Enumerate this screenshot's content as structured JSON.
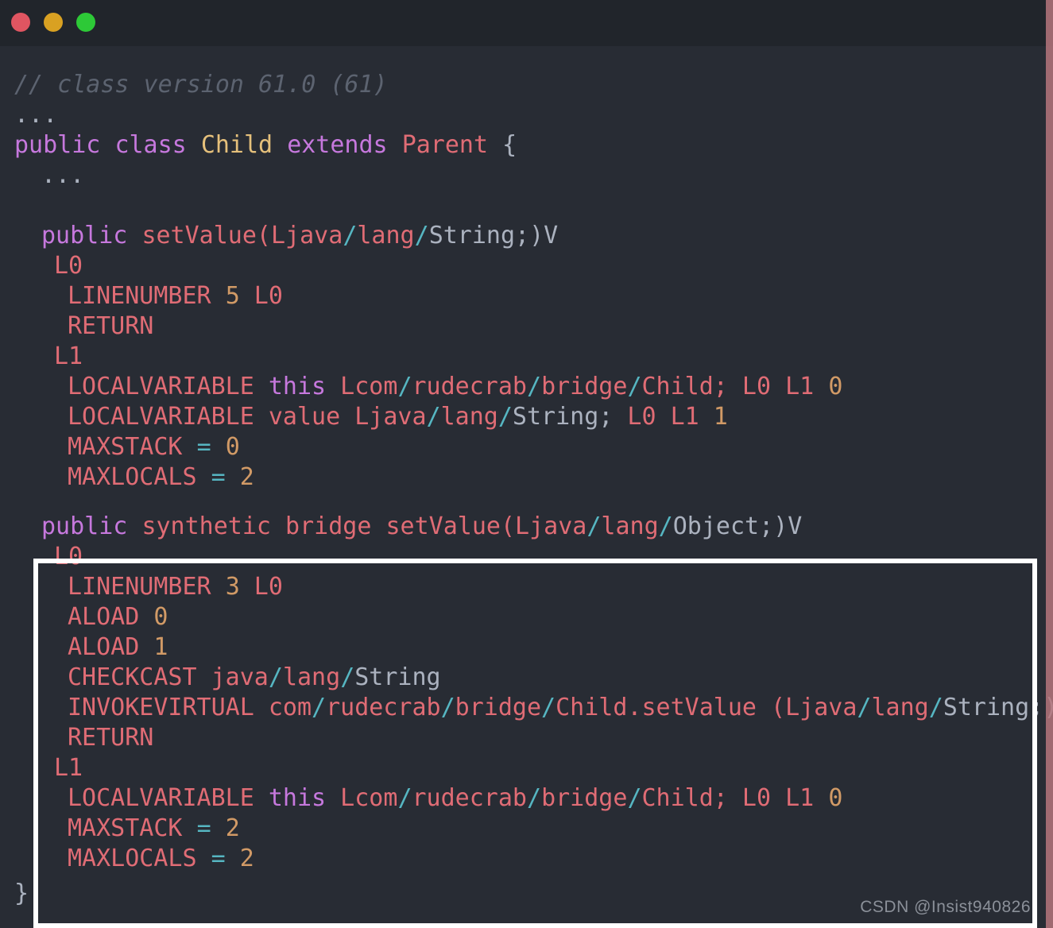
{
  "window": {
    "buttons": [
      {
        "name": "close",
        "color": "#e05561"
      },
      {
        "name": "minimize",
        "color": "#d9a122"
      },
      {
        "name": "maximize",
        "color": "#2dc937"
      }
    ]
  },
  "colors": {
    "background": "#282c34",
    "titlebar": "#21252b",
    "comment": "#5c6370",
    "keyword": "#c678dd",
    "class_name": "#e5c07b",
    "identifier": "#e06c75",
    "plain": "#abb2bf",
    "slash": "#56b6c2",
    "number": "#d19a66",
    "highlight_border": "#ffffff",
    "edge_strip": "#b5757c"
  },
  "code": {
    "language": "java-bytecode-asm",
    "lines": [
      {
        "id": "l01",
        "indent": 0,
        "tokens": [
          {
            "t": "// class version 61.0 (61)",
            "c": "cmt"
          }
        ]
      },
      {
        "id": "l02",
        "indent": 0,
        "tokens": [
          {
            "t": "...",
            "c": "dots"
          }
        ]
      },
      {
        "id": "l03",
        "indent": 0,
        "tokens": [
          {
            "t": "public",
            "c": "kw"
          },
          {
            "t": " ",
            "c": "wht"
          },
          {
            "t": "class",
            "c": "kw"
          },
          {
            "t": " ",
            "c": "wht"
          },
          {
            "t": "Child",
            "c": "cls"
          },
          {
            "t": " ",
            "c": "wht"
          },
          {
            "t": "extends",
            "c": "kw"
          },
          {
            "t": " ",
            "c": "wht"
          },
          {
            "t": "Parent",
            "c": "sal"
          },
          {
            "t": " ",
            "c": "wht"
          },
          {
            "t": "{",
            "c": "brc"
          }
        ]
      },
      {
        "id": "l04",
        "indent": 1,
        "tokens": [
          {
            "t": "...",
            "c": "dots"
          }
        ]
      },
      {
        "id": "l05",
        "indent": 0,
        "tokens": []
      },
      {
        "id": "l06",
        "indent": 1,
        "tokens": [
          {
            "t": "public",
            "c": "kw"
          },
          {
            "t": " ",
            "c": "wht"
          },
          {
            "t": "setValue(Ljava",
            "c": "pnk"
          },
          {
            "t": "/",
            "c": "sl"
          },
          {
            "t": "lang",
            "c": "pnk"
          },
          {
            "t": "/",
            "c": "sl"
          },
          {
            "t": "String;)V",
            "c": "wht"
          }
        ]
      },
      {
        "id": "l07",
        "indent": 2,
        "tokens": [
          {
            "t": "L0",
            "c": "pnk"
          }
        ]
      },
      {
        "id": "l08",
        "indent": 3,
        "tokens": [
          {
            "t": "LINENUMBER ",
            "c": "pnk"
          },
          {
            "t": "5",
            "c": "num"
          },
          {
            "t": " L0",
            "c": "pnk"
          }
        ]
      },
      {
        "id": "l09",
        "indent": 3,
        "tokens": [
          {
            "t": "RETURN",
            "c": "pnk"
          }
        ]
      },
      {
        "id": "l10",
        "indent": 2,
        "tokens": [
          {
            "t": "L1",
            "c": "pnk"
          }
        ]
      },
      {
        "id": "l11",
        "indent": 3,
        "tokens": [
          {
            "t": "LOCALVARIABLE ",
            "c": "pnk"
          },
          {
            "t": "this",
            "c": "kw"
          },
          {
            "t": " Lcom",
            "c": "pnk"
          },
          {
            "t": "/",
            "c": "sl"
          },
          {
            "t": "rudecrab",
            "c": "pnk"
          },
          {
            "t": "/",
            "c": "sl"
          },
          {
            "t": "bridge",
            "c": "pnk"
          },
          {
            "t": "/",
            "c": "sl"
          },
          {
            "t": "Child; L0 L1 ",
            "c": "pnk"
          },
          {
            "t": "0",
            "c": "num"
          }
        ]
      },
      {
        "id": "l12",
        "indent": 3,
        "tokens": [
          {
            "t": "LOCALVARIABLE value Ljava",
            "c": "pnk"
          },
          {
            "t": "/",
            "c": "sl"
          },
          {
            "t": "lang",
            "c": "pnk"
          },
          {
            "t": "/",
            "c": "sl"
          },
          {
            "t": "String;",
            "c": "wht"
          },
          {
            "t": " L0 L1 ",
            "c": "pnk"
          },
          {
            "t": "1",
            "c": "num"
          }
        ]
      },
      {
        "id": "l13",
        "indent": 3,
        "tokens": [
          {
            "t": "MAXSTACK ",
            "c": "pnk"
          },
          {
            "t": "=",
            "c": "op"
          },
          {
            "t": " ",
            "c": "wht"
          },
          {
            "t": "0",
            "c": "num"
          }
        ]
      },
      {
        "id": "l14",
        "indent": 3,
        "tokens": [
          {
            "t": "MAXLOCALS ",
            "c": "pnk"
          },
          {
            "t": "=",
            "c": "op"
          },
          {
            "t": " ",
            "c": "wht"
          },
          {
            "t": "2",
            "c": "num"
          }
        ]
      }
    ],
    "highlighted_lines": [
      {
        "id": "h01",
        "indent": 0,
        "tokens": [
          {
            "t": "public",
            "c": "kw"
          },
          {
            "t": " ",
            "c": "wht"
          },
          {
            "t": "synthetic bridge setValue(Ljava",
            "c": "pnk"
          },
          {
            "t": "/",
            "c": "sl"
          },
          {
            "t": "lang",
            "c": "pnk"
          },
          {
            "t": "/",
            "c": "sl"
          },
          {
            "t": "Object;)V",
            "c": "wht"
          }
        ]
      },
      {
        "id": "h02",
        "indent": 1,
        "tokens": [
          {
            "t": "L0",
            "c": "pnk"
          }
        ]
      },
      {
        "id": "h03",
        "indent": 2,
        "tokens": [
          {
            "t": "LINENUMBER ",
            "c": "pnk"
          },
          {
            "t": "3",
            "c": "num"
          },
          {
            "t": " L0",
            "c": "pnk"
          }
        ]
      },
      {
        "id": "h04",
        "indent": 2,
        "tokens": [
          {
            "t": "ALOAD ",
            "c": "pnk"
          },
          {
            "t": "0",
            "c": "num"
          }
        ]
      },
      {
        "id": "h05",
        "indent": 2,
        "tokens": [
          {
            "t": "ALOAD ",
            "c": "pnk"
          },
          {
            "t": "1",
            "c": "num"
          }
        ]
      },
      {
        "id": "h06",
        "indent": 2,
        "tokens": [
          {
            "t": "CHECKCAST java",
            "c": "pnk"
          },
          {
            "t": "/",
            "c": "sl"
          },
          {
            "t": "lang",
            "c": "pnk"
          },
          {
            "t": "/",
            "c": "sl"
          },
          {
            "t": "String",
            "c": "wht"
          }
        ]
      },
      {
        "id": "h07",
        "indent": 2,
        "tokens": [
          {
            "t": "INVOKEVIRTUAL com",
            "c": "pnk"
          },
          {
            "t": "/",
            "c": "sl"
          },
          {
            "t": "rudecrab",
            "c": "pnk"
          },
          {
            "t": "/",
            "c": "sl"
          },
          {
            "t": "bridge",
            "c": "pnk"
          },
          {
            "t": "/",
            "c": "sl"
          },
          {
            "t": "Child.setValue",
            "c": "pnk"
          },
          {
            "t": " ",
            "c": "wht"
          },
          {
            "t": "(Ljava",
            "c": "pnk"
          },
          {
            "t": "/",
            "c": "sl"
          },
          {
            "t": "lang",
            "c": "pnk"
          },
          {
            "t": "/",
            "c": "sl"
          },
          {
            "t": "String;)V",
            "c": "wht"
          }
        ]
      },
      {
        "id": "h08",
        "indent": 2,
        "tokens": [
          {
            "t": "RETURN",
            "c": "pnk"
          }
        ]
      },
      {
        "id": "h09",
        "indent": 1,
        "tokens": [
          {
            "t": "L1",
            "c": "pnk"
          }
        ]
      },
      {
        "id": "h10",
        "indent": 2,
        "tokens": [
          {
            "t": "LOCALVARIABLE ",
            "c": "pnk"
          },
          {
            "t": "this",
            "c": "kw"
          },
          {
            "t": " Lcom",
            "c": "pnk"
          },
          {
            "t": "/",
            "c": "sl"
          },
          {
            "t": "rudecrab",
            "c": "pnk"
          },
          {
            "t": "/",
            "c": "sl"
          },
          {
            "t": "bridge",
            "c": "pnk"
          },
          {
            "t": "/",
            "c": "sl"
          },
          {
            "t": "Child; L0 L1 ",
            "c": "pnk"
          },
          {
            "t": "0",
            "c": "num"
          }
        ]
      },
      {
        "id": "h11",
        "indent": 2,
        "tokens": [
          {
            "t": "MAXSTACK ",
            "c": "pnk"
          },
          {
            "t": "=",
            "c": "op"
          },
          {
            "t": " ",
            "c": "wht"
          },
          {
            "t": "2",
            "c": "num"
          }
        ]
      },
      {
        "id": "h12",
        "indent": 2,
        "tokens": [
          {
            "t": "MAXLOCALS ",
            "c": "pnk"
          },
          {
            "t": "=",
            "c": "op"
          },
          {
            "t": " ",
            "c": "wht"
          },
          {
            "t": "2",
            "c": "num"
          }
        ]
      }
    ],
    "closing_brace": {
      "id": "l-close",
      "indent": 0,
      "tokens": [
        {
          "t": "}",
          "c": "brc"
        }
      ]
    }
  },
  "watermark": {
    "text": "CSDN @Insist940826"
  }
}
